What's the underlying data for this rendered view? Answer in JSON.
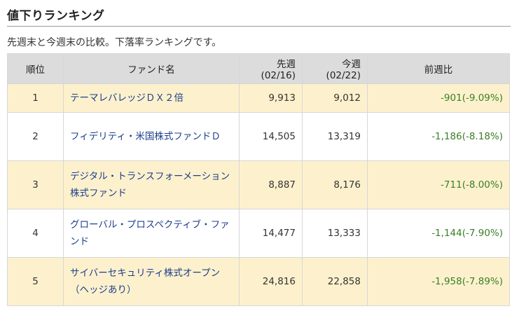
{
  "section": {
    "title": "値下りランキング",
    "description": "先週末と今週末の比較。下落率ランキングです。"
  },
  "table": {
    "headers": {
      "rank": "順位",
      "fund": "ファンド名",
      "prev_week": "先週(02/16)",
      "this_week": "今週(02/22)",
      "change": "前週比"
    },
    "rows": [
      {
        "rank": "1",
        "fund": "テーマレバレッジＤＸ２倍",
        "prev_week": "9,913",
        "this_week": "9,012",
        "change": "-901(-9.09%)"
      },
      {
        "rank": "2",
        "fund": "フィデリティ・米国株式ファンドＤ",
        "prev_week": "14,505",
        "this_week": "13,319",
        "change": "-1,186(-8.18%)"
      },
      {
        "rank": "3",
        "fund": "デジタル・トランスフォーメーション株式ファンド",
        "prev_week": "8,887",
        "this_week": "8,176",
        "change": "-711(-8.00%)"
      },
      {
        "rank": "4",
        "fund": "グローバル・プロスペクティブ・ファンド",
        "prev_week": "14,477",
        "this_week": "13,333",
        "change": "-1,144(-7.90%)"
      },
      {
        "rank": "5",
        "fund": "サイバーセキュリティ株式オープン（ヘッジあり）",
        "prev_week": "24,816",
        "this_week": "22,858",
        "change": "-1,958(-7.89%)"
      }
    ]
  },
  "colors": {
    "header_bg": "#dcdcdc",
    "odd_row_bg": "#fdf1cd",
    "link": "#1c3f8c",
    "change_text": "#3a7f25"
  }
}
